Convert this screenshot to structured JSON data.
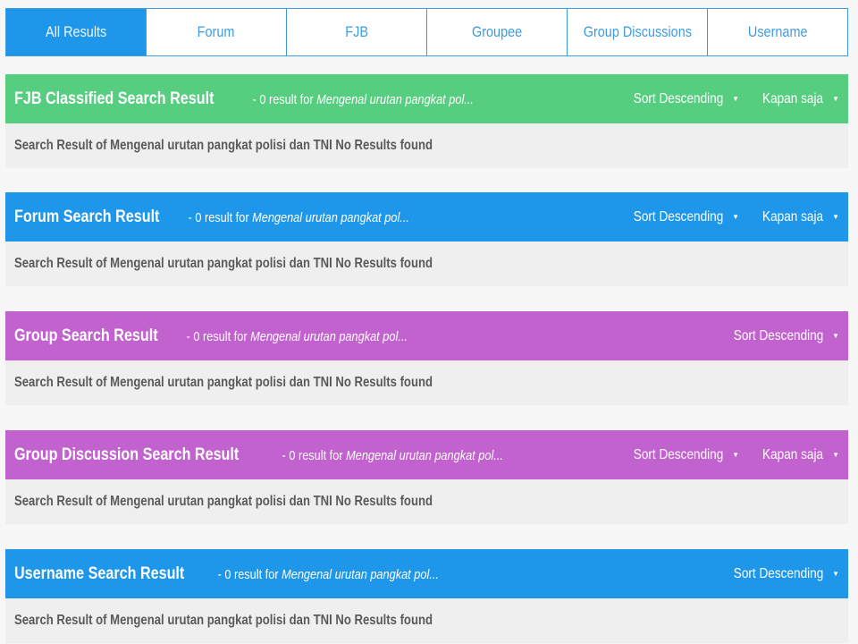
{
  "tabs": [
    {
      "label": "All Results",
      "active": true
    },
    {
      "label": "Forum",
      "active": false
    },
    {
      "label": "FJB",
      "active": false
    },
    {
      "label": "Groupee",
      "active": false
    },
    {
      "label": "Group Discussions",
      "active": false
    },
    {
      "label": "Username",
      "active": false
    }
  ],
  "colors": {
    "fjb": "#57cd80",
    "forum": "#1e96ea",
    "group": "#c262cf",
    "group_discussion": "#c262cf",
    "username": "#1e96ea",
    "tab_accent": "#3f9be0"
  },
  "sections": [
    {
      "title": "FJB Classified Search Result",
      "meta_prefix": " - 0 result for ",
      "query": "Mengenal urutan pangkat pol...",
      "sort_label": "Sort Descending",
      "time_label": "Kapan saja",
      "body": "Search Result of Mengenal urutan pangkat polisi dan TNI No Results found"
    },
    {
      "title": "Forum Search Result",
      "meta_prefix": " - 0 result for ",
      "query": "Mengenal urutan pangkat pol...",
      "sort_label": "Sort Descending",
      "time_label": "Kapan saja",
      "body": "Search Result of Mengenal urutan pangkat polisi dan TNI No Results found"
    },
    {
      "title": "Group Search Result",
      "meta_prefix": " - 0 result for ",
      "query": "Mengenal urutan pangkat pol...",
      "sort_label": "Sort Descending",
      "body": "Search Result of Mengenal urutan pangkat polisi dan TNI No Results found"
    },
    {
      "title": "Group Discussion Search Result",
      "meta_prefix": " - 0 result for ",
      "query": "Mengenal urutan pangkat pol...",
      "sort_label": "Sort Descending",
      "time_label": "Kapan saja",
      "body": "Search Result of Mengenal urutan pangkat polisi dan TNI No Results found"
    },
    {
      "title": "Username Search Result",
      "meta_prefix": " - 0 result for ",
      "query": "Mengenal urutan pangkat pol...",
      "sort_label": "Sort Descending",
      "body": "Search Result of Mengenal urutan pangkat polisi dan TNI No Results found"
    }
  ],
  "icons": {
    "caret": "▼"
  }
}
